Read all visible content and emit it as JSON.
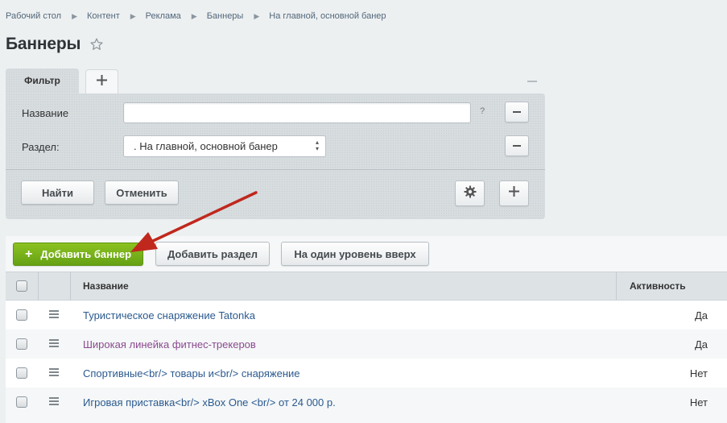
{
  "breadcrumb": [
    "Рабочий стол",
    "Контент",
    "Реклама",
    "Баннеры",
    "На главной, основной банер"
  ],
  "page_title": "Баннеры",
  "filter": {
    "tab_label": "Фильтр",
    "name_label": "Название",
    "name_value": "",
    "help": "?",
    "section_label": "Раздел:",
    "section_value": ". На главной, основной банер",
    "find_label": "Найти",
    "cancel_label": "Отменить"
  },
  "toolbar": {
    "add_banner_plus": "+",
    "add_banner_label": "Добавить баннер",
    "add_section_label": "Добавить раздел",
    "level_up_label": "На один уровень вверх"
  },
  "table": {
    "columns": [
      "Название",
      "Активность"
    ],
    "rows": [
      {
        "name": "Туристическое снаряжение Tatonka",
        "active": "Да"
      },
      {
        "name": "Широкая линейка фитнес-трекеров",
        "active": "Да"
      },
      {
        "name": "Спортивные<br/> товары и<br/> снаряжение",
        "active": "Нет"
      },
      {
        "name": "Игровая приставка<br/> xBox One <br/> от 24 000 р.",
        "active": "Нет"
      }
    ]
  },
  "colors": {
    "accent_green": "#6aa516",
    "link": "#2b5a8f",
    "visited_link": "#8a4a8e",
    "annotation_arrow": "#c0281d"
  },
  "icons": [
    "star-icon",
    "plus-icon",
    "minus-icon",
    "gear-icon",
    "menu-icon",
    "arrow-annotation"
  ]
}
